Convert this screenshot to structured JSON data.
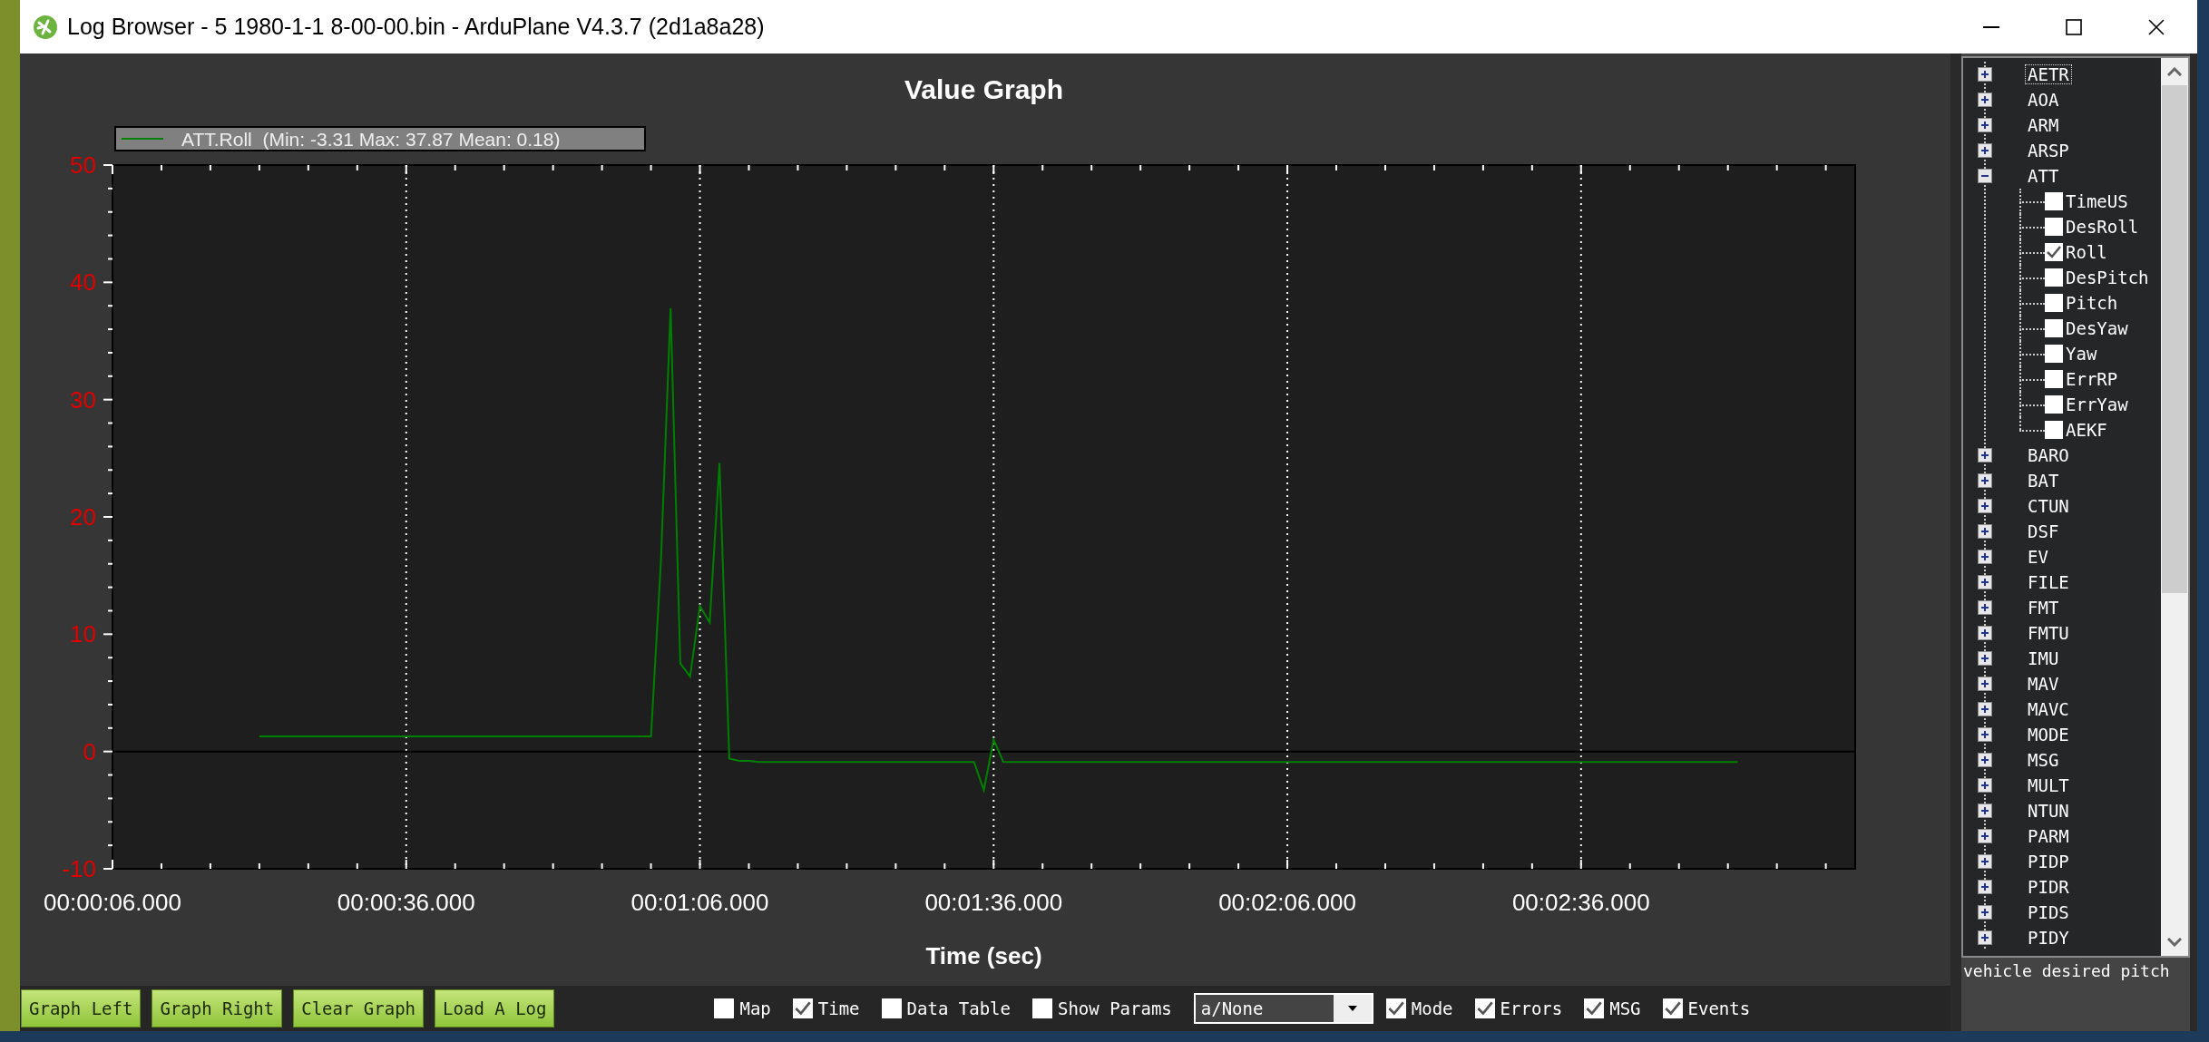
{
  "window": {
    "title": "Log Browser - 5 1980-1-1 8-00-00.bin - ArduPlane V4.3.7 (2d1a8a28)"
  },
  "graph": {
    "chart_data": {
      "type": "line",
      "title": "Value Graph",
      "xlabel": "Time (sec)",
      "categories": [
        "00:00:06.000",
        null,
        null,
        null,
        null,
        null,
        null,
        null,
        null,
        null,
        null,
        null,
        null,
        null,
        null,
        null,
        null,
        null,
        null,
        null,
        null,
        null,
        null,
        null,
        null,
        null,
        null,
        null,
        null,
        null,
        "00:00:36.000",
        null,
        null,
        null,
        null,
        null,
        null,
        null,
        null,
        null,
        null,
        null,
        null,
        null,
        null,
        null,
        null,
        null,
        null,
        null,
        null,
        null,
        null,
        null,
        null,
        null,
        null,
        null,
        null,
        null,
        "00:01:06.000",
        null,
        null,
        null,
        null,
        null,
        null,
        null,
        null,
        null,
        null,
        null,
        null,
        null,
        null,
        null,
        null,
        null,
        null,
        null,
        null,
        null,
        null,
        null,
        null,
        null,
        null,
        null,
        null,
        null,
        "00:01:36.000",
        null,
        null,
        null,
        null,
        null,
        null,
        null,
        null,
        null,
        null,
        null,
        null,
        null,
        null,
        null,
        null,
        null,
        null,
        null,
        null,
        null,
        null,
        null,
        null,
        null,
        null,
        null,
        null,
        null,
        "00:02:06.000",
        null,
        null,
        null,
        null,
        null,
        null,
        null,
        null,
        null,
        null,
        null,
        null,
        null,
        null,
        null,
        null,
        null,
        null,
        null,
        null,
        null,
        null,
        null,
        null,
        null,
        null,
        null,
        null,
        null,
        "00:02:36.000",
        null,
        null,
        null,
        null,
        null,
        null,
        null,
        null,
        null,
        null,
        null,
        null,
        null,
        null,
        null,
        null,
        null,
        null,
        null,
        null,
        null,
        null,
        null,
        null,
        null,
        null,
        null
      ],
      "series": [
        {
          "name": "ATT.Roll  (Min: -3.31 Max: 37.87 Mean: 0.18)",
          "color": "#008000",
          "values": [
            null,
            null,
            null,
            null,
            null,
            null,
            null,
            null,
            null,
            null,
            null,
            null,
            null,
            null,
            null,
            1.3,
            1.3,
            1.3,
            1.3,
            1.3,
            1.3,
            1.3,
            1.3,
            1.3,
            1.3,
            1.3,
            1.3,
            1.3,
            1.3,
            1.3,
            1.3,
            1.3,
            1.3,
            1.3,
            1.3,
            1.3,
            1.3,
            1.3,
            1.3,
            1.3,
            1.3,
            1.3,
            1.3,
            1.3,
            1.3,
            1.3,
            1.3,
            1.3,
            1.3,
            1.3,
            1.3,
            1.3,
            1.3,
            1.3,
            1.3,
            1.3,
            16,
            37.8,
            7.5,
            6.4,
            12.4,
            11,
            24.6,
            -0.6,
            -0.8,
            -0.8,
            -0.9,
            -0.9,
            -0.9,
            -0.9,
            -0.9,
            -0.9,
            -0.9,
            -0.9,
            -0.9,
            -0.9,
            -0.9,
            -0.9,
            -0.9,
            -0.9,
            -0.9,
            -0.9,
            -0.9,
            -0.9,
            -0.9,
            -0.9,
            -0.9,
            -0.9,
            -0.9,
            -3.3,
            1,
            -0.9,
            -0.9,
            -0.9,
            -0.9,
            -0.9,
            -0.9,
            -0.9,
            -0.9,
            -0.9,
            -0.9,
            -0.9,
            -0.9,
            -0.9,
            -0.9,
            -0.9,
            -0.9,
            -0.9,
            -0.9,
            -0.9,
            -0.9,
            -0.9,
            -0.9,
            -0.9,
            -0.9,
            -0.9,
            -0.9,
            -0.9,
            -0.9,
            -0.9,
            -0.9,
            -0.9,
            -0.9,
            -0.9,
            -0.9,
            -0.9,
            -0.9,
            -0.9,
            -0.9,
            -0.9,
            -0.9,
            -0.9,
            -0.9,
            -0.9,
            -0.9,
            -0.9,
            -0.9,
            -0.9,
            -0.9,
            -0.9,
            -0.9,
            -0.9,
            -0.9,
            -0.9,
            -0.9,
            -0.9,
            -0.9,
            -0.9,
            -0.9,
            -0.9,
            -0.9,
            -0.9,
            -0.9,
            -0.9,
            -0.9,
            -0.9,
            -0.9,
            -0.9,
            -0.9,
            -0.9,
            -0.9,
            -0.9,
            -0.9,
            -0.9,
            -0.9,
            -0.9,
            -0.9,
            null,
            null,
            null,
            null,
            null,
            null,
            null,
            null,
            null,
            null,
            null
          ]
        }
      ],
      "ylim": [
        -10,
        50
      ],
      "yticks": [
        -10,
        0,
        10,
        20,
        30,
        40,
        50
      ]
    }
  },
  "tree": {
    "items": [
      {
        "label": "AETR",
        "expanded": false,
        "selected": true
      },
      {
        "label": "AOA",
        "expanded": false,
        "selected": false
      },
      {
        "label": "ARM",
        "expanded": false,
        "selected": false
      },
      {
        "label": "ARSP",
        "expanded": false,
        "selected": false
      },
      {
        "label": "ATT",
        "expanded": true,
        "selected": false,
        "children": [
          {
            "label": "TimeUS",
            "checked": false
          },
          {
            "label": "DesRoll",
            "checked": false
          },
          {
            "label": "Roll",
            "checked": true
          },
          {
            "label": "DesPitch",
            "checked": false
          },
          {
            "label": "Pitch",
            "checked": false
          },
          {
            "label": "DesYaw",
            "checked": false
          },
          {
            "label": "Yaw",
            "checked": false
          },
          {
            "label": "ErrRP",
            "checked": false
          },
          {
            "label": "ErrYaw",
            "checked": false
          },
          {
            "label": "AEKF",
            "checked": false
          }
        ]
      },
      {
        "label": "BARO",
        "expanded": false,
        "selected": false
      },
      {
        "label": "BAT",
        "expanded": false,
        "selected": false
      },
      {
        "label": "CTUN",
        "expanded": false,
        "selected": false
      },
      {
        "label": "DSF",
        "expanded": false,
        "selected": false
      },
      {
        "label": "EV",
        "expanded": false,
        "selected": false
      },
      {
        "label": "FILE",
        "expanded": false,
        "selected": false
      },
      {
        "label": "FMT",
        "expanded": false,
        "selected": false
      },
      {
        "label": "FMTU",
        "expanded": false,
        "selected": false
      },
      {
        "label": "IMU",
        "expanded": false,
        "selected": false
      },
      {
        "label": "MAV",
        "expanded": false,
        "selected": false
      },
      {
        "label": "MAVC",
        "expanded": false,
        "selected": false
      },
      {
        "label": "MODE",
        "expanded": false,
        "selected": false
      },
      {
        "label": "MSG",
        "expanded": false,
        "selected": false
      },
      {
        "label": "MULT",
        "expanded": false,
        "selected": false
      },
      {
        "label": "NTUN",
        "expanded": false,
        "selected": false
      },
      {
        "label": "PARM",
        "expanded": false,
        "selected": false
      },
      {
        "label": "PIDP",
        "expanded": false,
        "selected": false
      },
      {
        "label": "PIDR",
        "expanded": false,
        "selected": false
      },
      {
        "label": "PIDS",
        "expanded": false,
        "selected": false
      },
      {
        "label": "PIDY",
        "expanded": false,
        "selected": false
      }
    ]
  },
  "description": "vehicle desired pitch",
  "buttons": [
    "Graph Left",
    "Graph Right",
    "Clear Graph",
    "Load A Log"
  ],
  "options": [
    {
      "kind": "checkbox",
      "label": "Map",
      "checked": false
    },
    {
      "kind": "checkbox",
      "label": "Time",
      "checked": true
    },
    {
      "kind": "checkbox",
      "label": "Data Table",
      "checked": false
    },
    {
      "kind": "checkbox",
      "label": "Show Params",
      "checked": false
    },
    {
      "kind": "dropdown",
      "value": "a/None"
    },
    {
      "kind": "checkbox",
      "label": "Mode",
      "checked": true
    },
    {
      "kind": "checkbox",
      "label": "Errors",
      "checked": true
    },
    {
      "kind": "checkbox",
      "label": "MSG",
      "checked": true
    },
    {
      "kind": "checkbox",
      "label": "Events",
      "checked": true
    }
  ]
}
